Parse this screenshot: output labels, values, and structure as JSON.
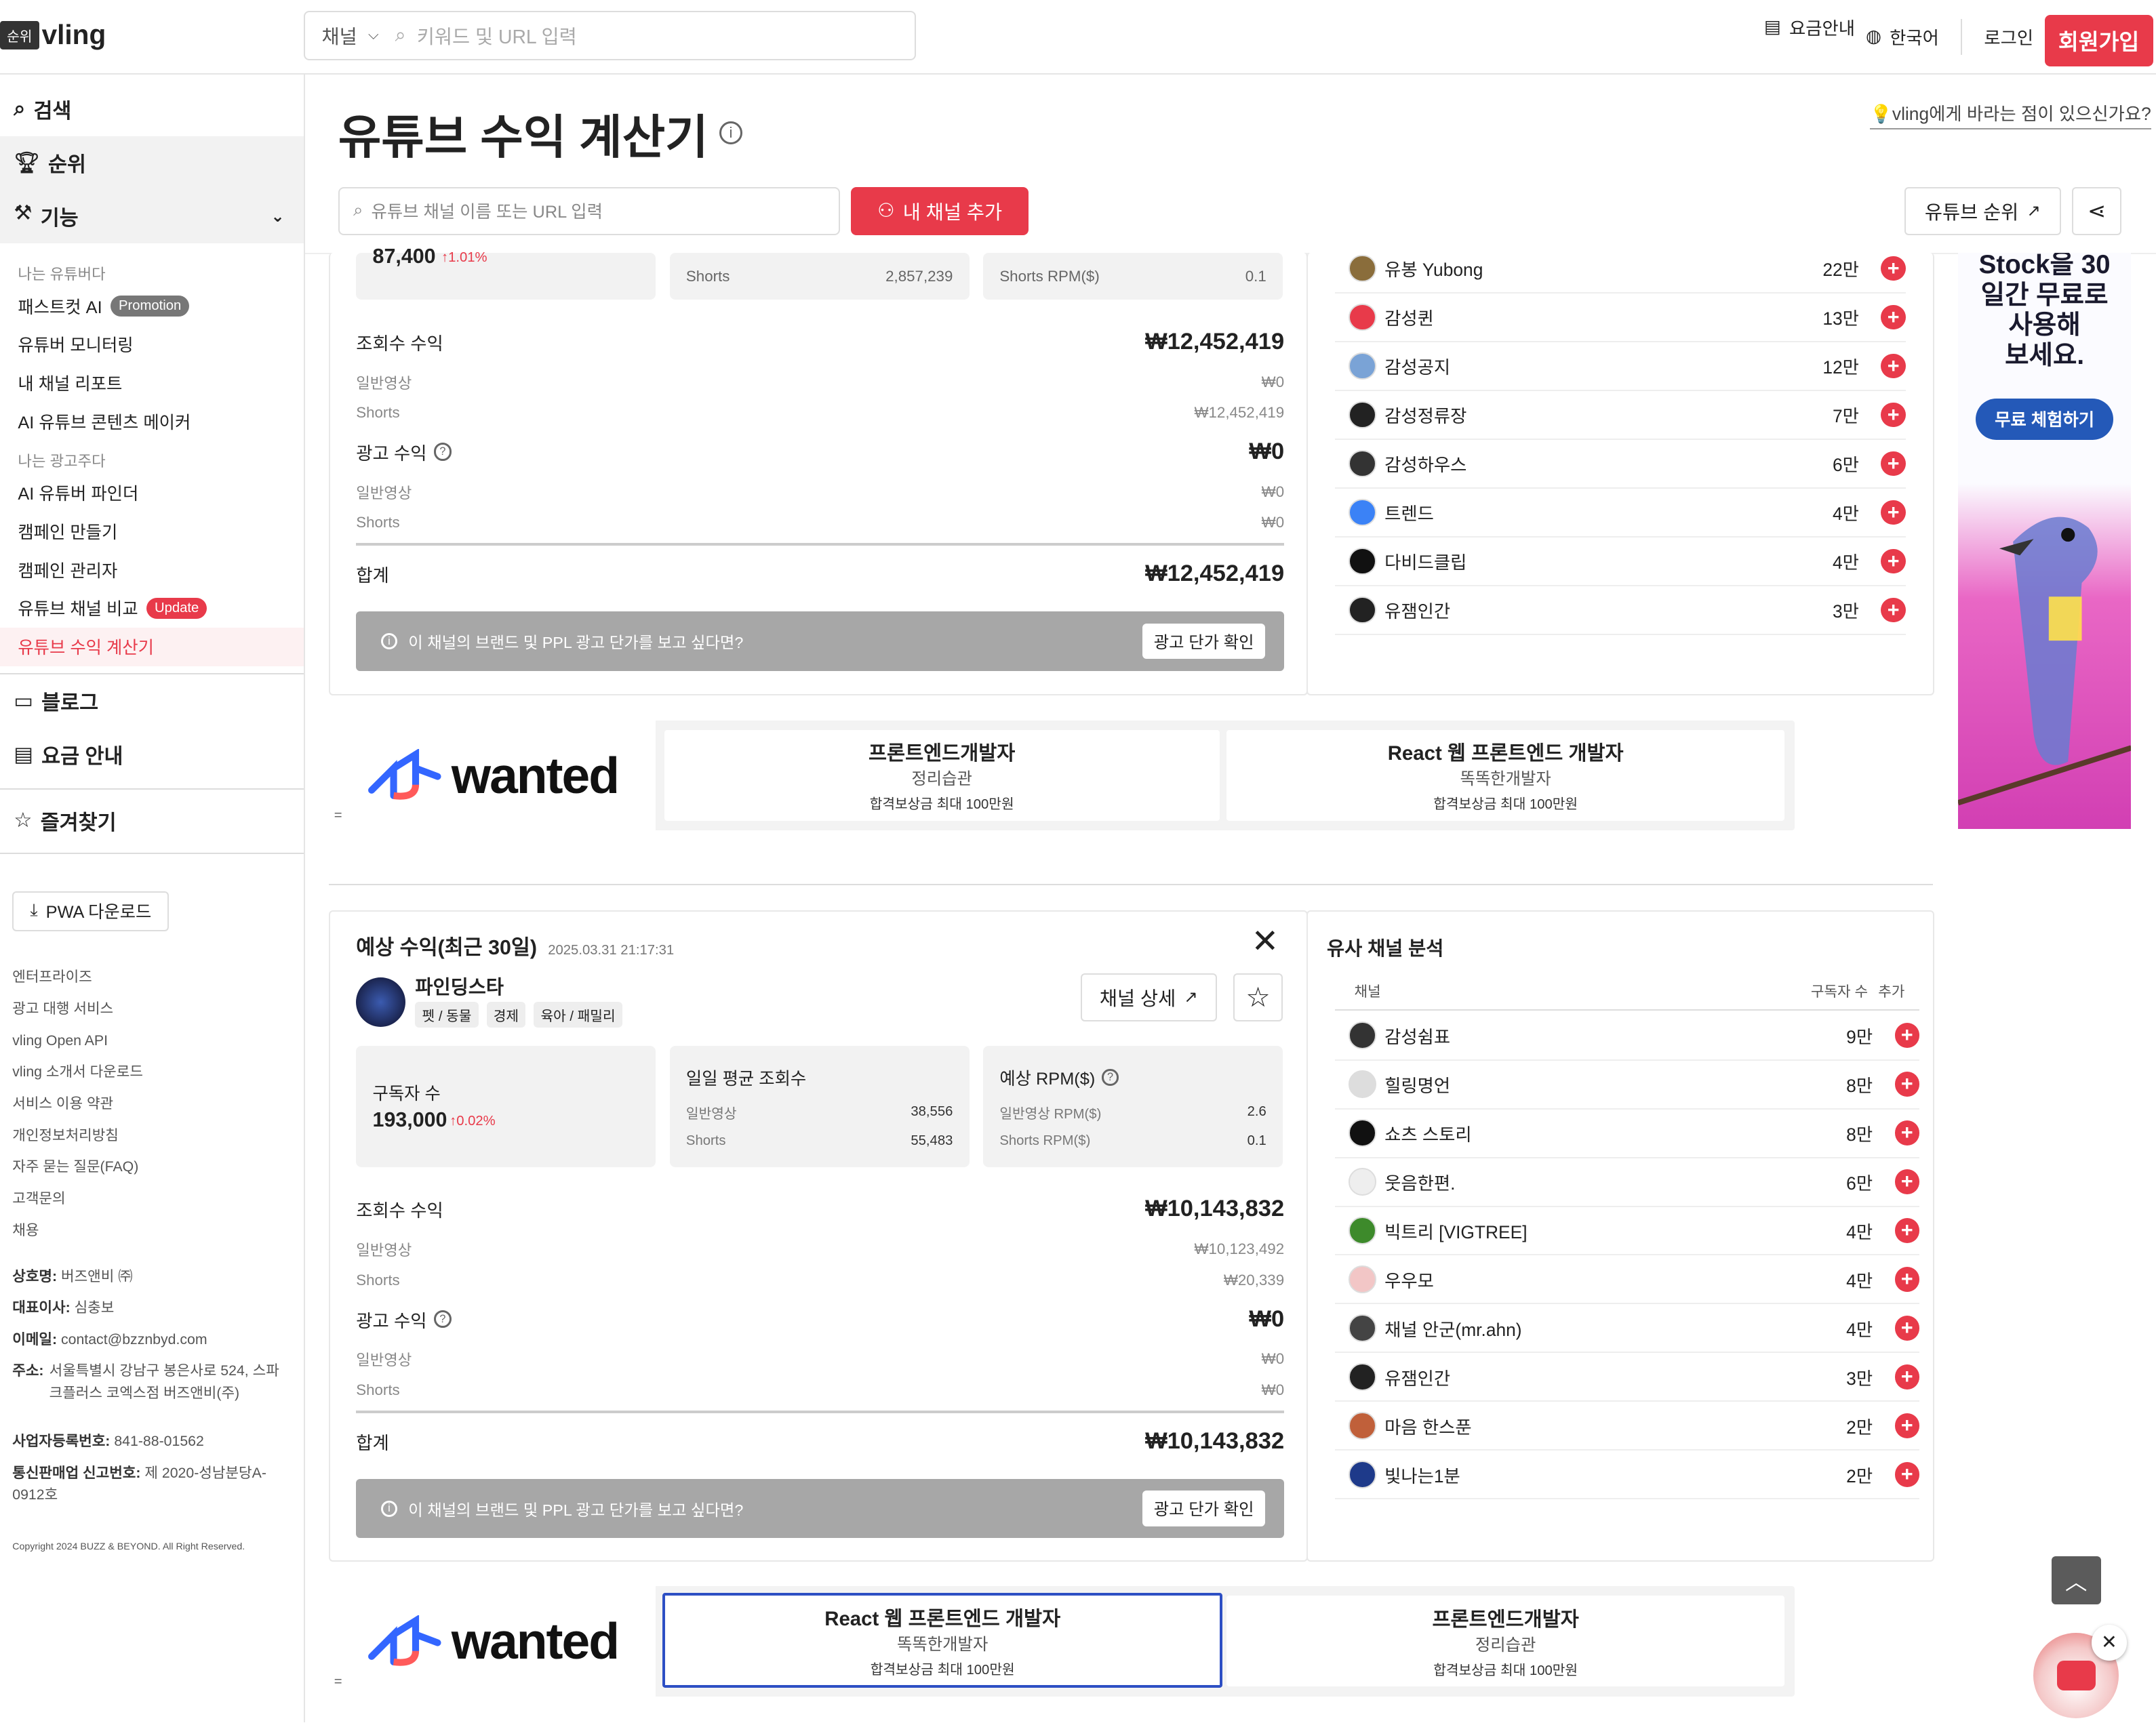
{
  "header": {
    "rank_tag": "순위",
    "brand": "vling",
    "channel_select": "채널",
    "search_placeholder": "키워드 및 URL 입력",
    "pricing": "요금안내",
    "language": "한국어",
    "login": "로그인",
    "signup": "회원가입"
  },
  "sidebar": {
    "main": [
      {
        "label": "검색"
      },
      {
        "label": "순위"
      },
      {
        "label": "기능"
      }
    ],
    "cap1": "나는 유튜버다",
    "youtuber_items": [
      {
        "label": "패스트컷 AI",
        "badge": "Promotion"
      },
      {
        "label": "유튜버 모니터링"
      },
      {
        "label": "내 채널 리포트"
      },
      {
        "label": "AI 유튜브 콘텐츠 메이커"
      }
    ],
    "cap2": "나는 광고주다",
    "advertiser_items": [
      {
        "label": "AI 유튜버 파인더"
      },
      {
        "label": "캠페인 만들기"
      },
      {
        "label": "캠페인 관리자"
      },
      {
        "label": "유튜브 채널 비교",
        "badge": "Update"
      },
      {
        "label": "유튜브 수익 계산기"
      }
    ],
    "blog": "블로그",
    "pricing": "요금 안내",
    "favorites": "즐겨찾기",
    "pwa": "PWA 다운로드",
    "footer_links": [
      "엔터프라이즈",
      "광고 대행 서비스",
      "vling Open API",
      "vling 소개서 다운로드",
      "서비스 이용 약관",
      "개인정보처리방침",
      "자주 묻는 질문(FAQ)",
      "고객문의",
      "채용"
    ],
    "company": {
      "name_k": "상호명:",
      "name_v": "버즈앤비 ㈜",
      "ceo_k": "대표이사:",
      "ceo_v": "심충보",
      "email_k": "이메일:",
      "email_v": "contact@bzznbyd.com",
      "addr_k": "주소:",
      "addr_v": "서울특별시 강남구 봉은사로 524, 스파크플러스 코엑스점 버즈앤비(주)",
      "biz_k": "사업자등록번호:",
      "biz_v": "841-88-01562",
      "mail_k": "통신판매업 신고번호:",
      "mail_v": "제 2020-성남분당A-0912호",
      "copyright": "Copyright 2024 BUZZ & BEYOND. All Right Reserved."
    }
  },
  "page": {
    "title": "유튜브 수익 계산기",
    "feedback": "💡vling에게 바라는 점이 있으신가요?",
    "search_placeholder": "유튜브 채널 이름 또는 URL 입력",
    "add_channel": "내 채널 추가",
    "rank_btn": "유튜브 순위"
  },
  "calc1": {
    "sub_partial": "87,400",
    "sub_pct": "↑1.01%",
    "shorts_label": "Shorts",
    "shorts_views": "2,857,239",
    "shorts_rpm_label": "Shorts RPM($)",
    "shorts_rpm": "0.1",
    "view_rev_label": "조회수 수익",
    "view_rev": "₩12,452,419",
    "normal_label": "일반영상",
    "normal_val": "₩0",
    "shorts_val": "₩12,452,419",
    "ad_label": "광고 수익",
    "ad_val": "₩0",
    "ad_normal": "₩0",
    "ad_shorts": "₩0",
    "total_label": "합계",
    "total": "₩12,452,419",
    "banner": "이 채널의 브랜드 및 PPL 광고 단가를 보고 싶다면?",
    "banner_btn": "광고 단가 확인"
  },
  "similar1": [
    {
      "name": "유봉 Yubong",
      "subs": "22만",
      "color": "#8a6d3b"
    },
    {
      "name": "감성퀸",
      "subs": "13만",
      "color": "#e83a4a"
    },
    {
      "name": "감성공지",
      "subs": "12만",
      "color": "#7aa3d6"
    },
    {
      "name": "감성정류장",
      "subs": "7만",
      "color": "#222"
    },
    {
      "name": "감성하우스",
      "subs": "6만",
      "color": "#333"
    },
    {
      "name": "트렌드",
      "subs": "4만",
      "color": "#3b82f6"
    },
    {
      "name": "다비드클립",
      "subs": "4만",
      "color": "#111"
    },
    {
      "name": "유잼인간",
      "subs": "3만",
      "color": "#222"
    }
  ],
  "ad_side": {
    "line1": "Stock을 30",
    "line2": "일간 무료로",
    "line3": "사용해",
    "line4": "보세요.",
    "cta": "무료 체험하기"
  },
  "wanted1": {
    "logo": "wanted",
    "jobs": [
      {
        "title": "프론트엔드개발자",
        "company": "정리습관",
        "reward": "합격보상금 최대 100만원"
      },
      {
        "title": "React 웹 프론트엔드 개발자",
        "company": "똑똑한개발자",
        "reward": "합격보상금 최대 100만원"
      }
    ]
  },
  "calc2": {
    "heading": "예상 수익(최근 30일)",
    "date": "2025.03.31 21:17:31",
    "channel": "파인딩스타",
    "tags": [
      "펫 / 동물",
      "경제",
      "육아 / 패밀리"
    ],
    "detail_btn": "채널 상세",
    "subs_label": "구독자 수",
    "subs": "193,000",
    "subs_pct": "↑0.02%",
    "daily_label": "일일 평균 조회수",
    "normal_label": "일반영상",
    "daily_normal": "38,556",
    "shorts_label": "Shorts",
    "daily_shorts": "55,483",
    "rpm_label": "예상 RPM($)",
    "rpm_normal_label": "일반영상 RPM($)",
    "rpm_normal": "2.6",
    "rpm_shorts_label": "Shorts RPM($)",
    "rpm_shorts": "0.1",
    "view_rev_label": "조회수 수익",
    "view_rev": "₩10,143,832",
    "normal_val": "₩10,123,492",
    "shorts_val": "₩20,339",
    "ad_label": "광고 수익",
    "ad_val": "₩0",
    "ad_normal": "₩0",
    "ad_shorts": "₩0",
    "total_label": "합계",
    "total": "₩10,143,832",
    "banner": "이 채널의 브랜드 및 PPL 광고 단가를 보고 싶다면?",
    "banner_btn": "광고 단가 확인"
  },
  "similar2": {
    "title": "유사 채널 분석",
    "col_channel": "채널",
    "col_subs": "구독자 수",
    "col_add": "추가",
    "rows": [
      {
        "name": "감성쉼표",
        "subs": "9만",
        "color": "#333"
      },
      {
        "name": "힐링명언",
        "subs": "8만",
        "color": "#ddd"
      },
      {
        "name": "쇼츠 스토리",
        "subs": "8만",
        "color": "#111"
      },
      {
        "name": "웃음한편.",
        "subs": "6만",
        "color": "#eee"
      },
      {
        "name": "빅트리 [VIGTREE]",
        "subs": "4만",
        "color": "#3d8a2b"
      },
      {
        "name": "우우모",
        "subs": "4만",
        "color": "#f2c6c6"
      },
      {
        "name": "채널 안군(mr.ahn)",
        "subs": "4만",
        "color": "#444"
      },
      {
        "name": "유잼인간",
        "subs": "3만",
        "color": "#222"
      },
      {
        "name": "마음 한스푼",
        "subs": "2만",
        "color": "#c0603a"
      },
      {
        "name": "빛나는1분",
        "subs": "2만",
        "color": "#1e3a8a"
      }
    ]
  },
  "wanted2": {
    "logo": "wanted",
    "jobs": [
      {
        "title": "React 웹 프론트엔드 개발자",
        "company": "똑똑한개발자",
        "reward": "합격보상금 최대 100만원"
      },
      {
        "title": "프론트엔드개발자",
        "company": "정리습관",
        "reward": "합격보상금 최대 100만원"
      }
    ]
  }
}
